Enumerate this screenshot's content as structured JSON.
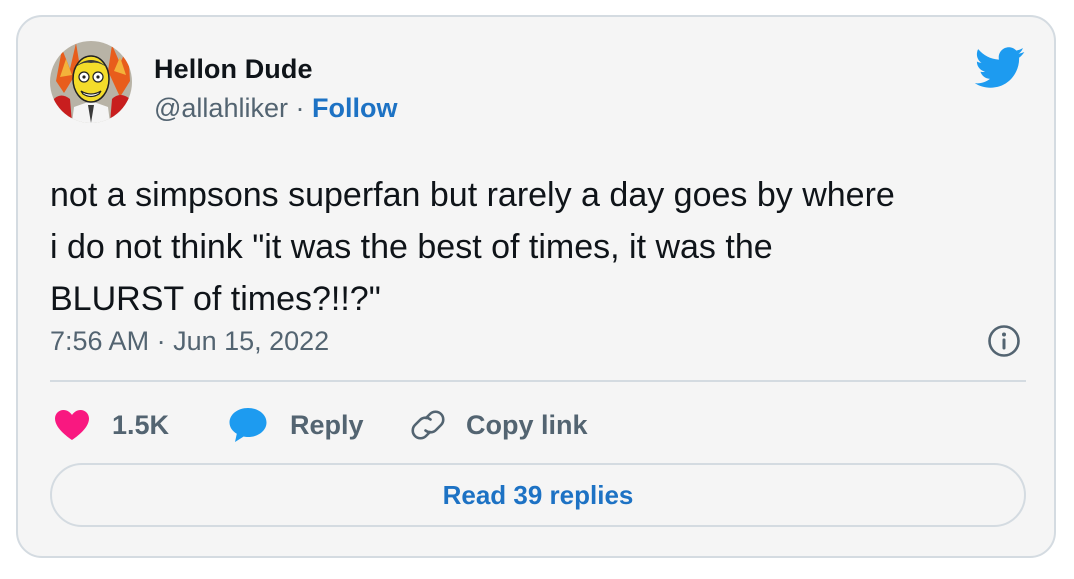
{
  "author": {
    "name": "Hellon Dude",
    "handle": "@allahliker",
    "separator": " · ",
    "follow_label": "Follow"
  },
  "tweet": {
    "text": "not a simpsons superfan but rarely a day goes by where\ni do not think \"it was the best of times, it was the\nBLURST of times?!!?\"",
    "time": "7:56 AM",
    "date": "Jun 15, 2022",
    "timestamp_separator": " · "
  },
  "actions": {
    "like_count": "1.5K",
    "reply_label": "Reply",
    "copy_link_label": "Copy link"
  },
  "read_replies_label": "Read 39 replies",
  "icons": {
    "brand": "twitter-bird-icon",
    "info": "info-icon",
    "like": "heart-icon",
    "reply": "speech-bubble-icon",
    "copy": "link-icon"
  },
  "colors": {
    "like": "#f91880",
    "reply": "#1d9bf0",
    "link": "#1d72c4",
    "brand": "#1d9bf0"
  }
}
